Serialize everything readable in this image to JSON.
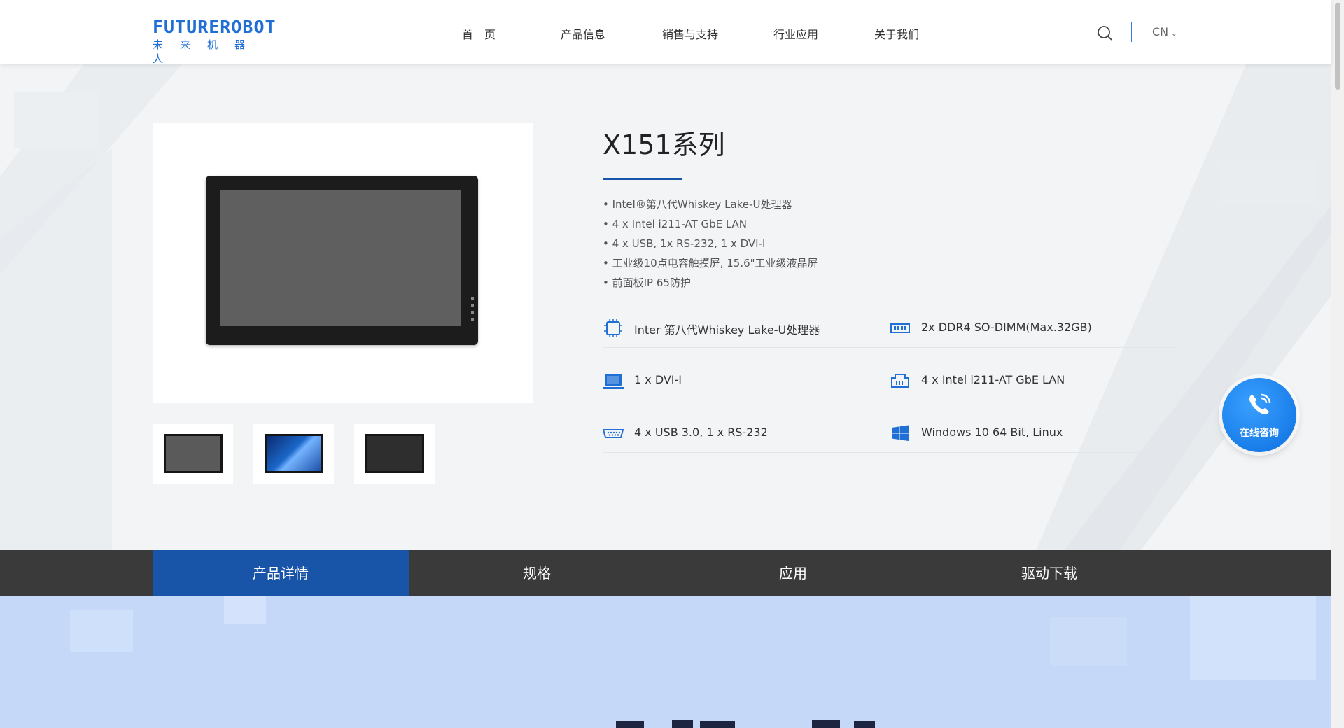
{
  "header": {
    "logo_en": "FUTUREROBOT",
    "logo_cn": "未来机器人",
    "nav": [
      {
        "label": "首　页",
        "name": "nav-home"
      },
      {
        "label": "产品信息",
        "name": "nav-products"
      },
      {
        "label": "销售与支持",
        "name": "nav-sales-support"
      },
      {
        "label": "行业应用",
        "name": "nav-industry"
      },
      {
        "label": "关于我们",
        "name": "nav-about"
      }
    ],
    "search_icon": "search-icon",
    "lang": "CN"
  },
  "product": {
    "title": "X151系列",
    "features": [
      "• Intel®第八代Whiskey Lake-U处理器",
      "• 4 x Intel i211-AT GbE LAN",
      "• 4 x USB, 1x RS-232, 1 x DVI-I",
      "• 工业级10点电容触摸屏, 15.6\"工业级液晶屏",
      "• 前面板IP 65防护"
    ],
    "specs": [
      {
        "icon": "cpu-icon",
        "text": "Inter 第八代Whiskey Lake-U处理器"
      },
      {
        "icon": "memory-icon",
        "text": "2x DDR4 SO-DIMM(Max.32GB)"
      },
      {
        "icon": "display-icon",
        "text": "1 x DVI-I"
      },
      {
        "icon": "lan-icon",
        "text": "4 x Intel i211-AT GbE LAN"
      },
      {
        "icon": "usb-port-icon",
        "text": "4 x USB 3.0, 1 x RS-232"
      },
      {
        "icon": "windows-icon",
        "text": "Windows 10 64 Bit, Linux"
      }
    ]
  },
  "consult": {
    "label": "在线咨询",
    "icon": "phone-icon"
  },
  "tabs": [
    {
      "label": "产品详情",
      "active": true
    },
    {
      "label": "规格",
      "active": false
    },
    {
      "label": "应用",
      "active": false
    },
    {
      "label": "驱动下载",
      "active": false
    }
  ],
  "colors": {
    "brand_blue": "#1f6fd4",
    "active_tab": "#1854a8",
    "tab_bar": "#3a3a3a",
    "consult_blue": "#0c6fe0"
  }
}
